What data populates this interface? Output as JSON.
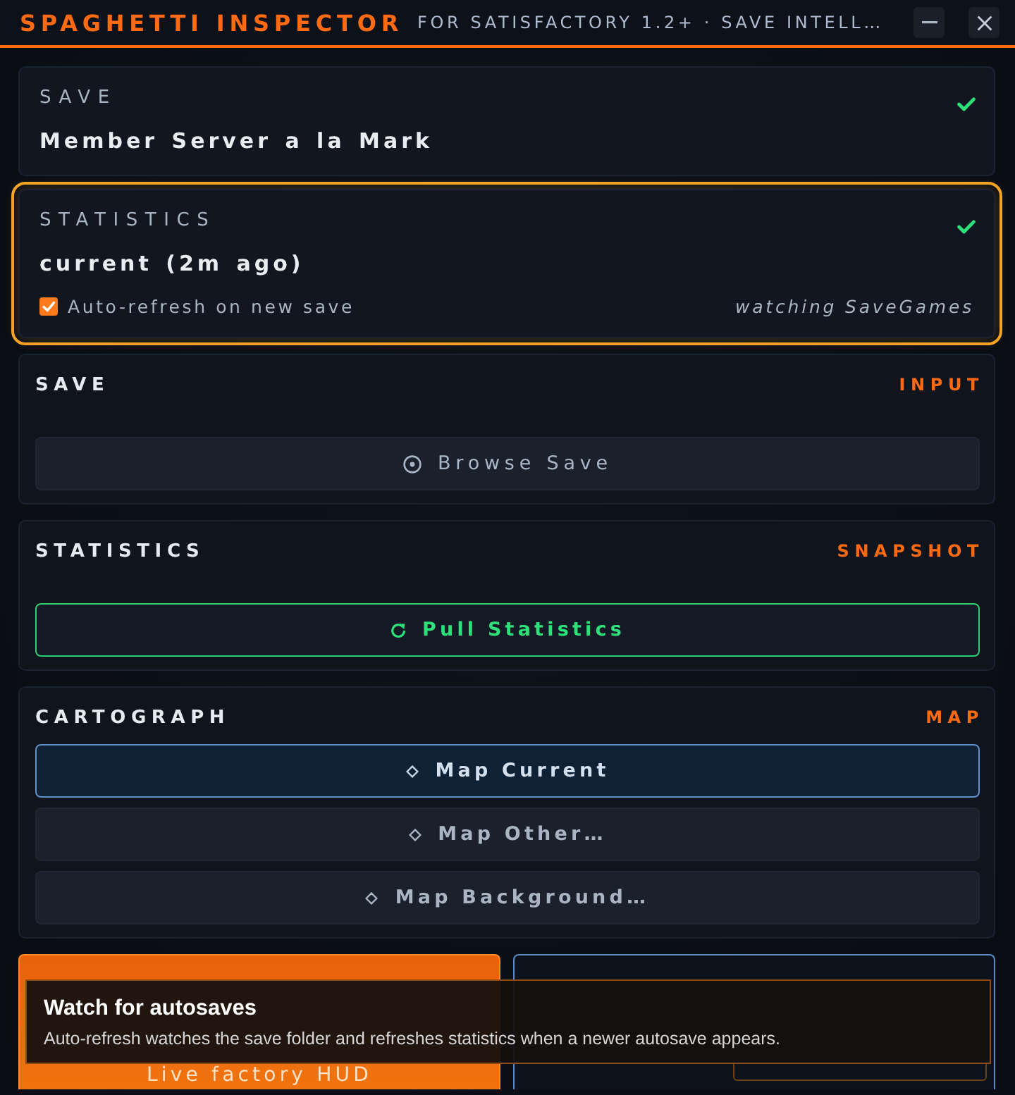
{
  "window": {
    "title": "SPAGHETTI INSPECTOR",
    "subtitle": "FOR SATISFACTORY 1.2+ · SAVE INTELL…"
  },
  "status_cards": [
    {
      "label": "SAVE",
      "value": "Member Server a la Mark",
      "ok": true,
      "highlighted": false
    },
    {
      "label": "STATISTICS",
      "value": "current (2m ago)",
      "ok": true,
      "highlighted": true,
      "auto_refresh": {
        "label": "Auto-refresh on new save",
        "checked": true
      },
      "watch_note": "watching SaveGames"
    }
  ],
  "sections": [
    {
      "title": "SAVE",
      "tag": "INPUT",
      "buttons": [
        {
          "kind": "plain",
          "label": "Browse Save"
        }
      ]
    },
    {
      "title": "STATISTICS",
      "tag": "SNAPSHOT",
      "buttons": [
        {
          "kind": "success",
          "label": "Pull Statistics"
        }
      ]
    },
    {
      "title": "CARTOGRAPH",
      "tag": "MAP",
      "buttons": [
        {
          "kind": "active",
          "label": "Map Current"
        },
        {
          "kind": "option",
          "label": "Map Other…"
        },
        {
          "kind": "option",
          "label": "Map Background…"
        }
      ]
    }
  ],
  "actions": [
    {
      "kind": "primary",
      "sublabel": "Live factory HUD"
    },
    {
      "kind": "outline"
    }
  ],
  "tooltip": {
    "title": "Watch for autosaves",
    "text": "Auto-refresh watches the save folder and refreshes statistics when a newer autosave appears."
  }
}
